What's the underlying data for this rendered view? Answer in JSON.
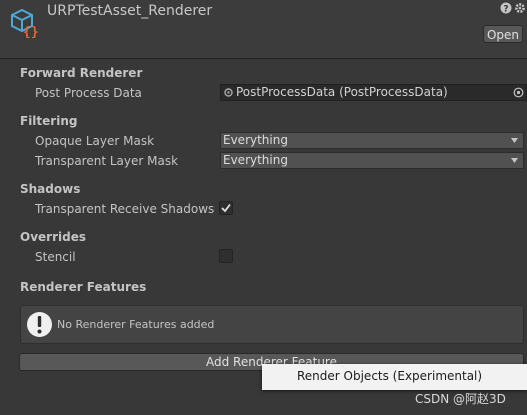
{
  "header": {
    "title": "URPTestAsset_Renderer",
    "open_label": "Open",
    "icons": [
      "asset-icon",
      "help-icon",
      "settings-icon"
    ]
  },
  "forward_renderer": {
    "heading": "Forward Renderer",
    "post_process_label": "Post Process Data",
    "post_process_value": "PostProcessData (PostProcessData)"
  },
  "filtering": {
    "heading": "Filtering",
    "opaque_label": "Opaque Layer Mask",
    "opaque_value": "Everything",
    "transparent_label": "Transparent Layer Mask",
    "transparent_value": "Everything"
  },
  "shadows": {
    "heading": "Shadows",
    "receive_label": "Transparent Receive Shadows",
    "receive_checked": true
  },
  "overrides": {
    "heading": "Overrides",
    "stencil_label": "Stencil",
    "stencil_checked": false
  },
  "renderer_features": {
    "heading": "Renderer Features",
    "empty_message": "No Renderer Features added",
    "add_label": "Add Renderer Feature"
  },
  "context_menu": {
    "items": [
      "Render Objects (Experimental)"
    ]
  },
  "watermark": "CSDN @阿赵3D",
  "colors": {
    "background": "#383838",
    "field": "#2a2a2a",
    "button": "#585858",
    "menu": "#f2f2f2",
    "asset_icon_blue": "#4fa8d6",
    "asset_icon_orange": "#e06a2f"
  }
}
